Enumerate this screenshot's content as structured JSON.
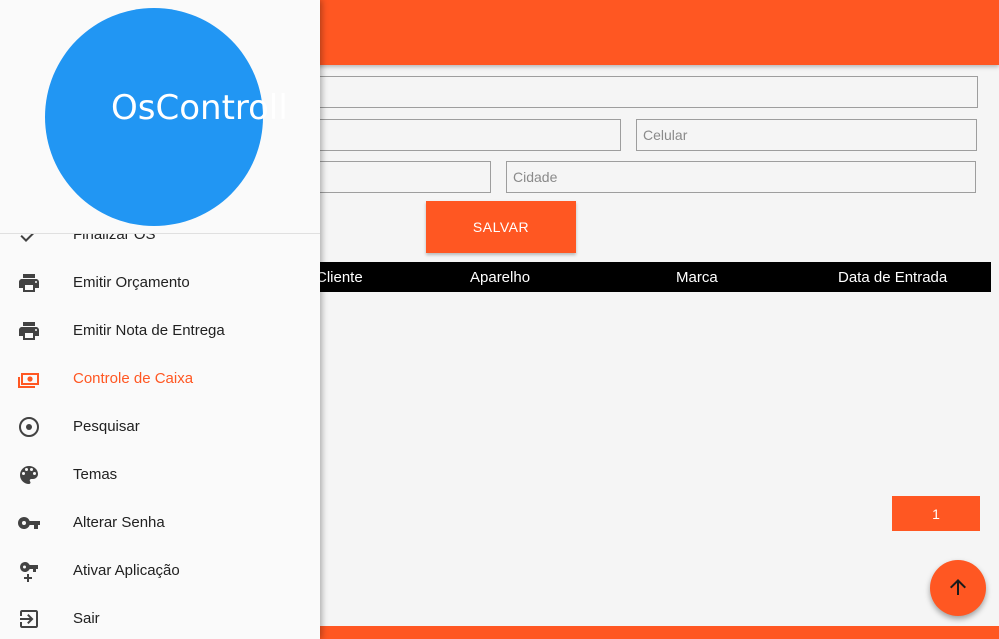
{
  "app": {
    "logo_text": "OsControll",
    "accent_color": "#ff5722",
    "logo_color": "#2196f3"
  },
  "form": {
    "celular_placeholder": "Celular",
    "cidade_placeholder": "Cidade",
    "save_label": "SALVAR"
  },
  "table": {
    "columns": [
      "Cliente",
      "Aparelho",
      "Marca",
      "Data de Entrada"
    ]
  },
  "pagination": {
    "current_page": "1"
  },
  "drawer": {
    "items": [
      {
        "label": "Finalizar OS",
        "icon": "check-icon"
      },
      {
        "label": "Emitir Orçamento",
        "icon": "printer-icon"
      },
      {
        "label": "Emitir Nota de Entrega",
        "icon": "printer-icon"
      },
      {
        "label": "Controle de Caixa",
        "icon": "money-icon",
        "active": true
      },
      {
        "label": "Pesquisar",
        "icon": "radio-target-icon"
      },
      {
        "label": "Temas",
        "icon": "palette-icon"
      },
      {
        "label": "Alterar Senha",
        "icon": "key-icon"
      },
      {
        "label": "Ativar Aplicação",
        "icon": "key-plus-icon"
      },
      {
        "label": "Sair",
        "icon": "exit-icon"
      }
    ]
  }
}
